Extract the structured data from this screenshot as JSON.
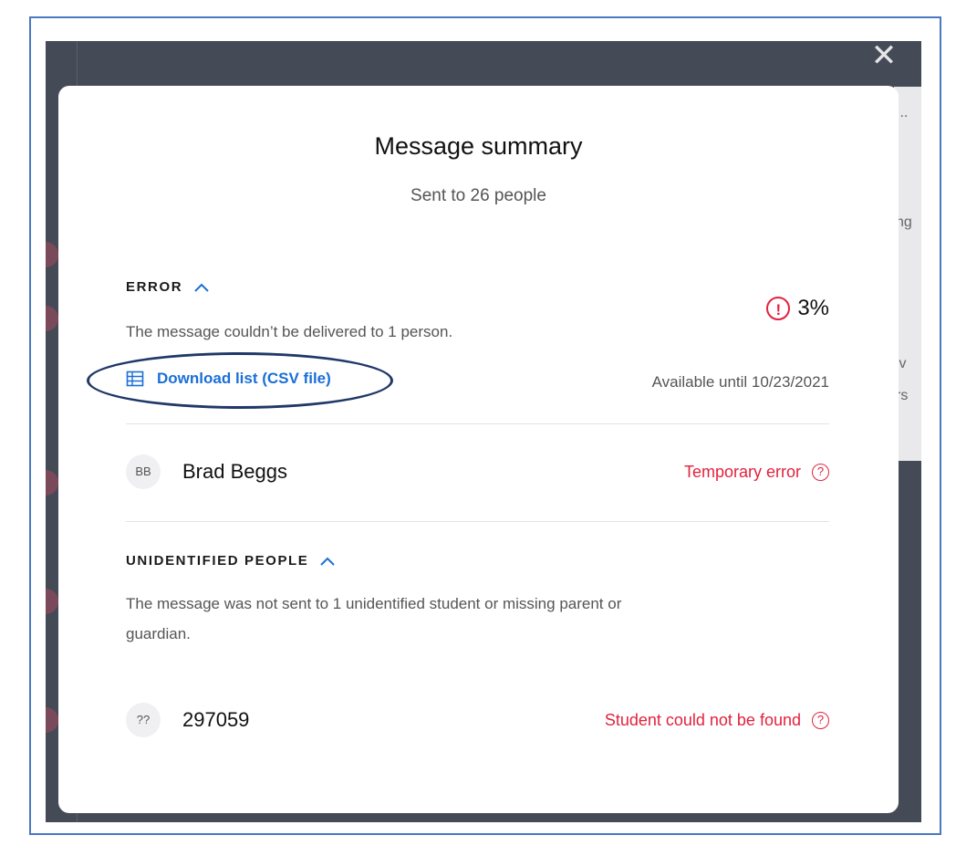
{
  "modal": {
    "close_glyph": "✕",
    "title": "Message summary",
    "subtitle": "Sent to 26 people"
  },
  "error_section": {
    "heading": "ERROR",
    "description": "The message couldn’t be delivered to 1 person.",
    "percent": "3%",
    "warning_glyph": "!",
    "download_label": "Download list (CSV file)",
    "available_until": "Available until 10/23/2021",
    "rows": [
      {
        "initials": "BB",
        "name": "Brad Beggs",
        "status": "Temporary error",
        "help_glyph": "?"
      }
    ]
  },
  "unidentified_section": {
    "heading": "UNIDENTIFIED PEOPLE",
    "description_line1": "The message was not sent to 1 unidentified student or missing parent or",
    "description_line2": "guardian.",
    "rows": [
      {
        "initials": "??",
        "name": "297059",
        "status": "Student could not be found",
        "help_glyph": "?"
      }
    ]
  },
  "background": {
    "fragment_1": "...",
    "fragment_2": "ng",
    "fragment_3": "iv",
    "fragment_4": "rs"
  },
  "colors": {
    "accent": "#1a6fd6",
    "error": "#e2223e",
    "overlay": "#454a57"
  },
  "icons": {
    "close": "close-icon",
    "warning": "warning-circle-icon",
    "chevron": "chevron-up-icon",
    "table": "table-icon",
    "help": "help-circle-icon"
  }
}
